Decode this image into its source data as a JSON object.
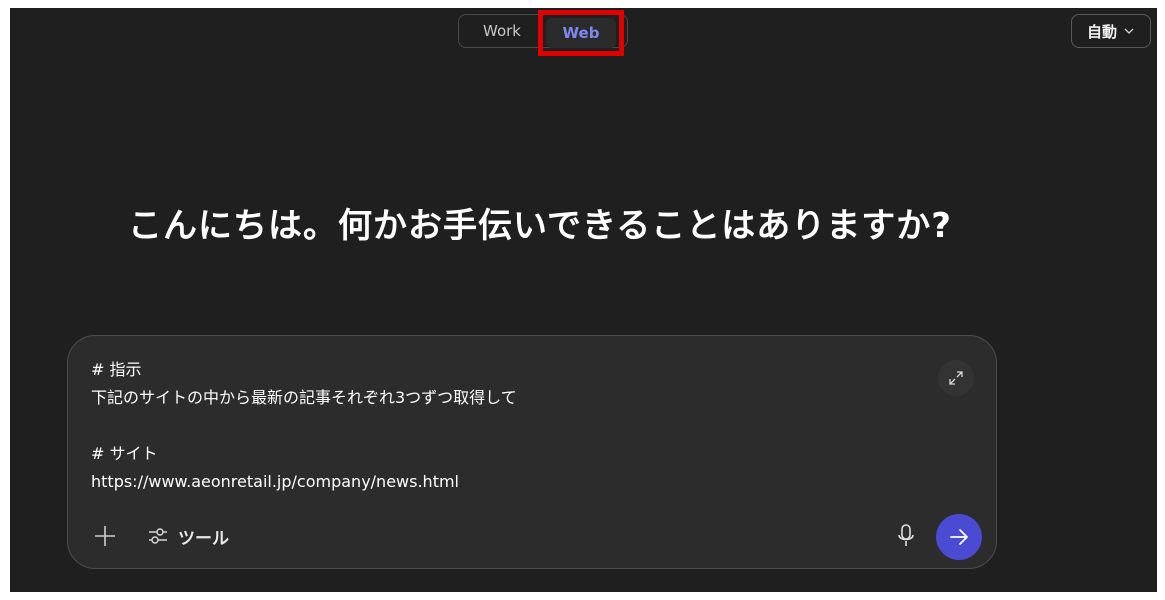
{
  "header": {
    "modes": {
      "work_label": "Work",
      "web_label": "Web"
    },
    "auto_select": {
      "label": "自動",
      "icon": "chevron-down-icon"
    }
  },
  "main": {
    "greeting": "こんにちは。何かお手伝いできることはありますか?"
  },
  "composer": {
    "text": "# 指示\n下記のサイトの中から最新の記事それぞれ3つずつ取得して\n\n# サイト\nhttps://www.aeonretail.jp/company/news.html",
    "tools_label": "ツール",
    "icons": {
      "expand": "expand-icon",
      "plus": "plus-icon",
      "tools": "sliders-icon",
      "mic": "microphone-icon",
      "send": "arrow-right-icon"
    }
  },
  "colors": {
    "background": "#1f1f1f",
    "composer_bg": "#2c2c2c",
    "accent": "#4a4ad3",
    "web_active": "#7f88f0",
    "highlight": "#e00000"
  }
}
